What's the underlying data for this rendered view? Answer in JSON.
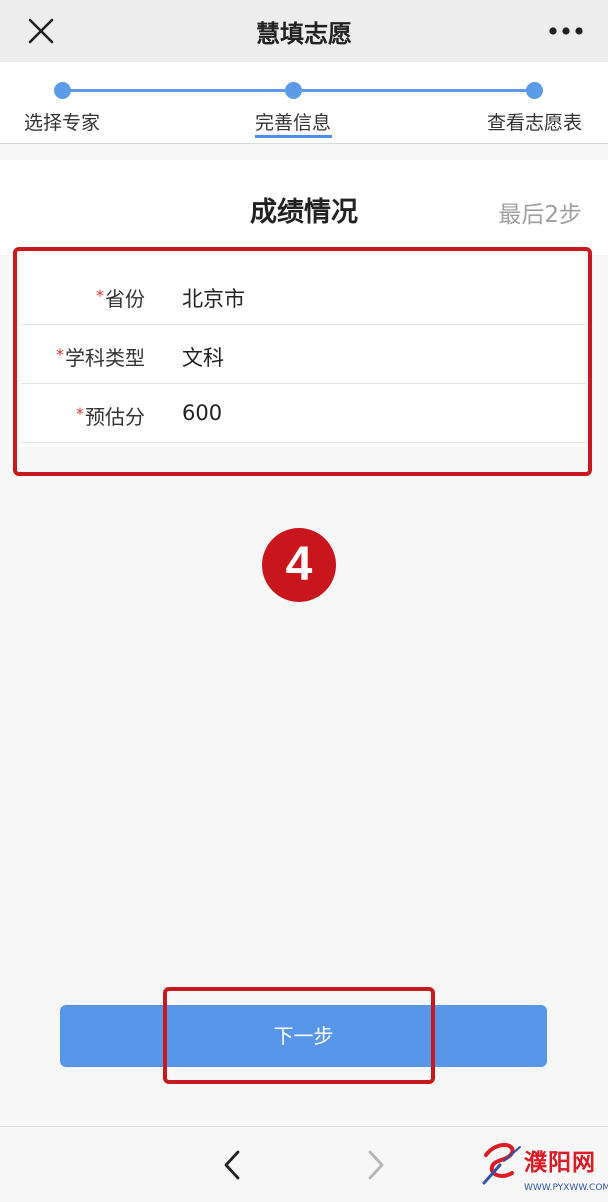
{
  "window": {
    "title": "慧填志愿"
  },
  "stepper": {
    "steps": [
      "选择专家",
      "完善信息",
      "查看志愿表"
    ],
    "current": 1
  },
  "section": {
    "title": "成绩情况",
    "steps_left": "最后2步"
  },
  "form": {
    "fields": [
      {
        "required_mark": "*",
        "label": "省份",
        "value": "北京市"
      },
      {
        "required_mark": "*",
        "label": "学科类型",
        "value": "文科"
      },
      {
        "required_mark": "*",
        "label": "预估分",
        "value": "600"
      }
    ]
  },
  "annotation": {
    "badge": "4"
  },
  "actions": {
    "next_label": "下一步"
  },
  "watermark": {
    "name": "濮阳网",
    "url": "WWW.PYXWW.COM"
  },
  "colors": {
    "accent": "#5896ea",
    "highlight": "#c8191f",
    "required": "#d63a3a"
  }
}
